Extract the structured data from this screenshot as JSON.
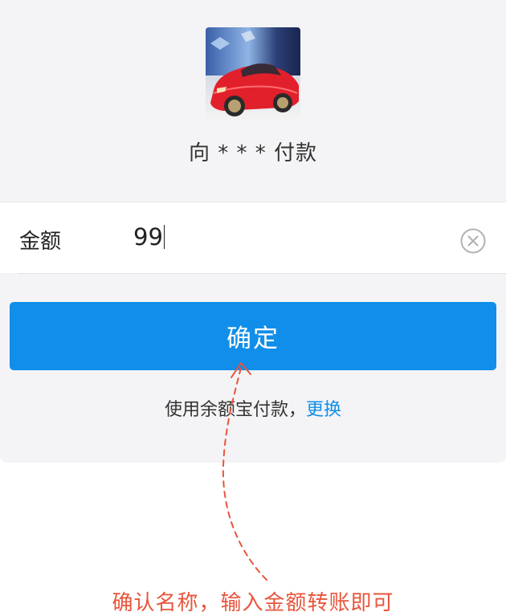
{
  "payee": {
    "text": "向 * * * 付款"
  },
  "amount": {
    "label": "金额",
    "value": "99"
  },
  "confirm_button": {
    "label": "确定"
  },
  "payment_method": {
    "text": "使用余额宝付款，",
    "change_link": "更换"
  },
  "annotation": {
    "text": "确认名称，输入金额转账即可"
  },
  "colors": {
    "primary": "#108ee9",
    "annotation": "#e8553c",
    "panel_bg": "#f4f4f6"
  },
  "icons": {
    "clear": "clear-circle-icon"
  }
}
